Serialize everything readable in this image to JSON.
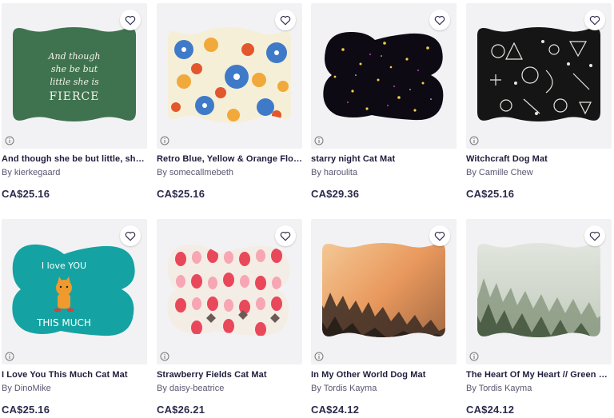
{
  "products": [
    {
      "title": "And though she be but little, she is...",
      "artist": "By kierkegaard",
      "price": "CA$25.16",
      "art_text": [
        "And though",
        "she be but",
        "little she is",
        "FIERCE"
      ]
    },
    {
      "title": "Retro Blue, Yellow & Orange Floral ...",
      "artist": "By somecallmebeth",
      "price": "CA$25.16"
    },
    {
      "title": "starry night Cat Mat",
      "artist": "By haroulita",
      "price": "CA$29.36"
    },
    {
      "title": "Witchcraft Dog Mat",
      "artist": "By Camille Chew",
      "price": "CA$25.16"
    },
    {
      "title": "I Love You This Much Cat Mat",
      "artist": "By DinoMike",
      "price": "CA$25.16",
      "art_text": [
        "I love YOU",
        "THIS MUCH"
      ]
    },
    {
      "title": "Strawberry Fields Cat Mat",
      "artist": "By daisy-beatrice",
      "price": "CA$26.21"
    },
    {
      "title": "In My Other World Dog Mat",
      "artist": "By Tordis Kayma",
      "price": "CA$24.12"
    },
    {
      "title": "The Heart Of My Heart // Green M...",
      "artist": "By Tordis Kayma",
      "price": "CA$24.12"
    }
  ],
  "icons": {
    "wishlist": "heart-outline-icon",
    "info": "info-circle-icon"
  },
  "colors": {
    "title": "#1f1d3d",
    "artist": "#5a5770",
    "price": "#2b2a4c",
    "thumb_bg": "#f2f2f4"
  }
}
